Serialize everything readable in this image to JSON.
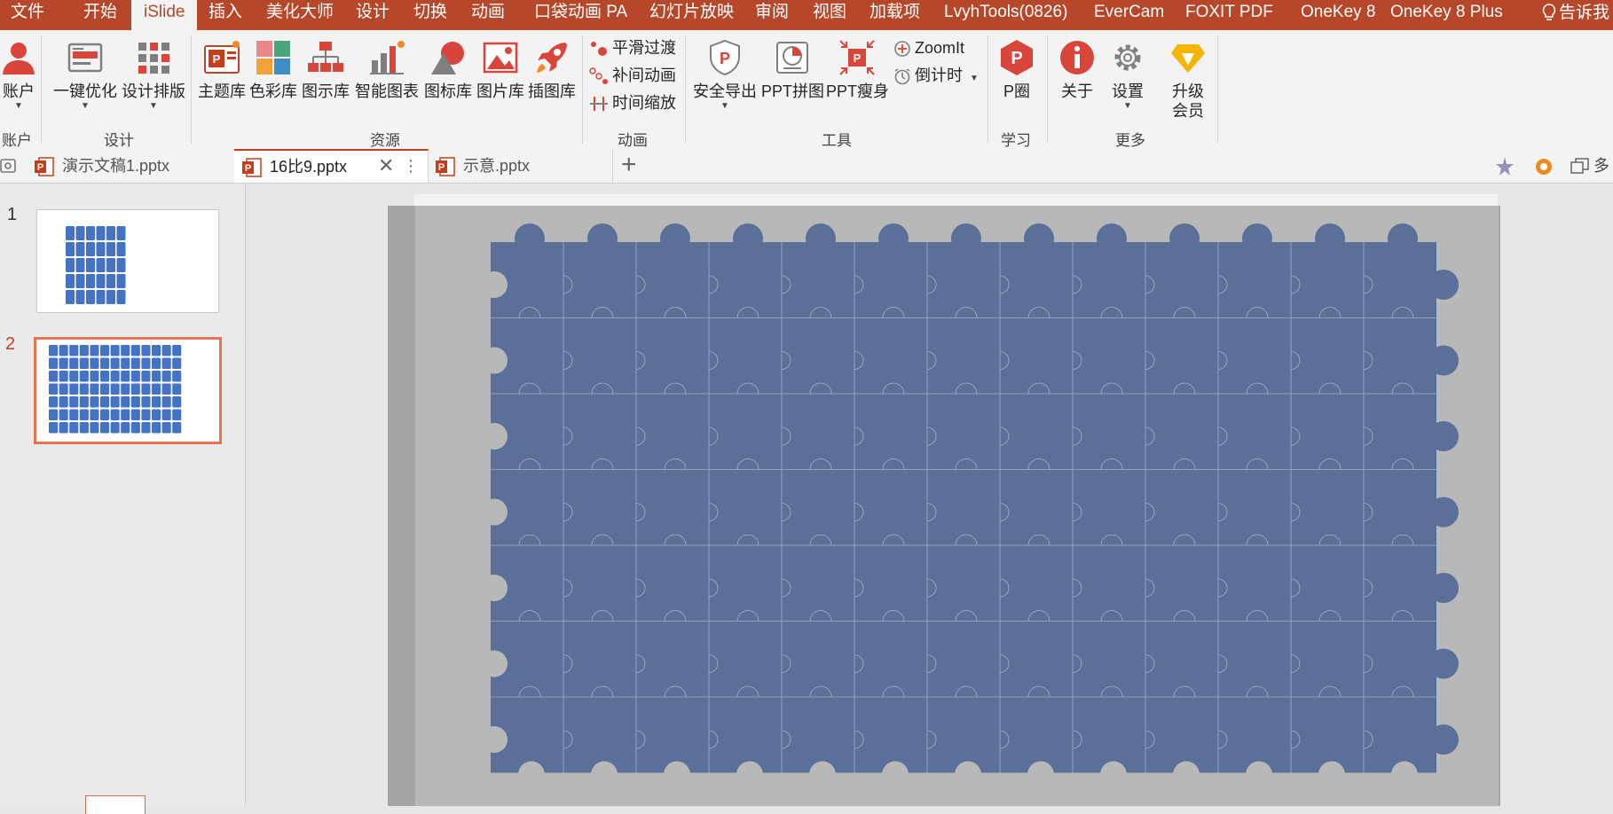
{
  "menu": {
    "items": [
      "文件",
      "开始",
      "iSlide",
      "插入",
      "美化大师",
      "设计",
      "切换",
      "动画",
      "口袋动画 PA",
      "幻灯片放映",
      "审阅",
      "视图",
      "加载项",
      "LvyhTools(0826)",
      "EverCam",
      "FOXIT PDF",
      "OneKey 8",
      "OneKey 8 Plus"
    ],
    "active_index": 2,
    "tell_me": "告诉我"
  },
  "ribbon": {
    "account": {
      "label": "账户",
      "group": "账户"
    },
    "design": {
      "items": [
        "一键优化",
        "设计排版"
      ],
      "group": "设计"
    },
    "resources": {
      "items": [
        "主题库",
        "色彩库",
        "图示库",
        "智能图表",
        "图标库",
        "图片库",
        "插图库"
      ],
      "group": "资源"
    },
    "animation": {
      "items": [
        "平滑过渡",
        "补间动画",
        "时间缩放"
      ],
      "group": "动画"
    },
    "tools": {
      "items": [
        "安全导出",
        "PPT拼图",
        "PPT瘦身"
      ],
      "zoomit": "ZoomIt",
      "countdown": "倒计时",
      "group": "工具"
    },
    "learn": {
      "label": "P圈",
      "group": "学习"
    },
    "more": {
      "about": "关于",
      "settings": "设置",
      "upgrade_line1": "升级",
      "upgrade_line2": "会员",
      "group": "更多"
    }
  },
  "tabs": {
    "items": [
      "演示文稿1.pptx",
      "16比9.pptx",
      "示意.pptx"
    ],
    "active_index": 1,
    "add": "+",
    "right_label": "多"
  },
  "slides": {
    "numbers": [
      "1",
      "2"
    ],
    "selected_index": 1
  },
  "colors": {
    "accent": "#b7472a",
    "puzzle": "#5a7099",
    "thumb_puzzle": "#4472c4",
    "slide_bg": "#b8b8b8"
  },
  "puzzle": {
    "columns": 13,
    "rows": 7
  }
}
